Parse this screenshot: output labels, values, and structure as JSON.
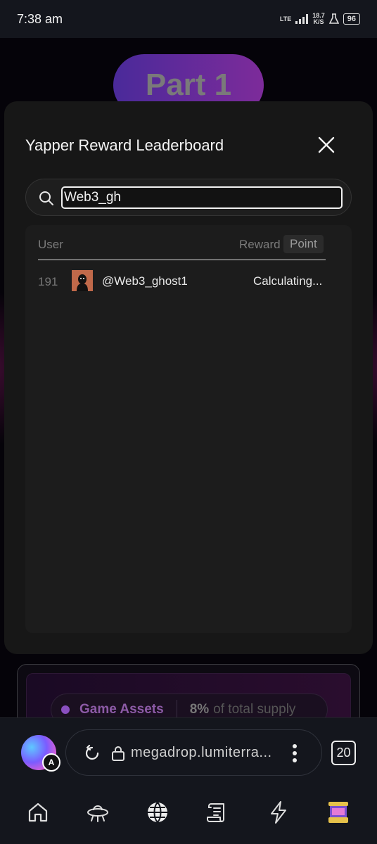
{
  "status_bar": {
    "time": "7:38 am",
    "network": "LTE",
    "speed_value": "18.7",
    "speed_unit": "K/S",
    "battery": "96"
  },
  "background_page": {
    "part_title": "Part 1",
    "supply": {
      "label": "Game Assets",
      "percent": "8%",
      "rest": "of total supply"
    }
  },
  "modal": {
    "title": "Yapper Reward Leaderboard",
    "search_value": "Web3_gh",
    "table": {
      "col_user": "User",
      "col_reward": "Reward",
      "col_point": "Point",
      "rows": [
        {
          "rank": "191",
          "handle": "@Web3_ghost1",
          "reward": "Calculating..."
        }
      ]
    }
  },
  "browser": {
    "orb_badge": "A",
    "url": "megadrop.lumiterra...",
    "tab_count": "20"
  },
  "bottom_nav": [
    "home-icon",
    "ufo-icon",
    "globe-icon",
    "scroll-icon",
    "lightning-icon",
    "game-app-icon"
  ],
  "colors": {
    "modal_bg": "#171717",
    "pill_gradient_start": "#4a2a9a",
    "pill_gradient_end": "#7d2b9a",
    "assets_accent": "#8c5aa6"
  }
}
